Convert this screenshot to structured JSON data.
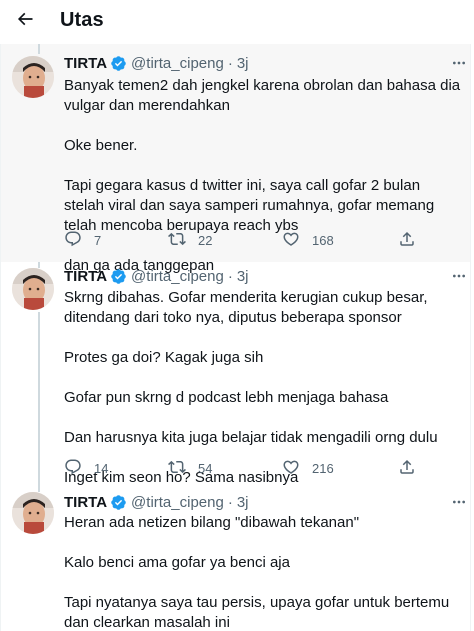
{
  "header": {
    "title": "Utas",
    "back_icon": "arrow-left-icon"
  },
  "colors": {
    "verified": "#1d9bf0",
    "text": "#0f1419",
    "muted": "#536471",
    "thread_line": "#cfd9de"
  },
  "tweets": [
    {
      "name": "TIRTA",
      "handle": "@tirta_cipeng",
      "time": "3j",
      "paragraphs": [
        "Banyak temen2 dah jengkel karena obrolan dan bahasa dia vulgar dan merendahkan",
        "Oke bener.",
        "Tapi gegara kasus d twitter ini, saya call gofar 2 bulan stelah viral dan saya samperi rumahnya, gofar memang telah mencoba berupaya reach ybs",
        "dan ga ada tanggepan"
      ],
      "replies": "7",
      "retweets": "22",
      "likes": "168"
    },
    {
      "name": "TIRTA",
      "handle": "@tirta_cipeng",
      "time": "3j",
      "paragraphs": [
        "Skrng dibahas. Gofar menderita kerugian cukup besar, ditendang dari toko nya, diputus beberapa sponsor",
        "Protes ga doi? Kagak juga sih",
        "Gofar pun skrng d podcast lebh menjaga bahasa",
        "Dan harusnya kita juga belajar tidak mengadili orng dulu",
        "Inget kim seon ho? Sama nasibnya"
      ],
      "replies": "14",
      "retweets": "54",
      "likes": "216"
    },
    {
      "name": "TIRTA",
      "handle": "@tirta_cipeng",
      "time": "3j",
      "paragraphs": [
        "Heran ada netizen bilang \"dibawah tekanan\"",
        "Kalo benci ama gofar ya benci aja",
        "Tapi nyatanya saya tau persis, upaya gofar untuk bertemu dan clearkan masalah ini"
      ]
    }
  ]
}
